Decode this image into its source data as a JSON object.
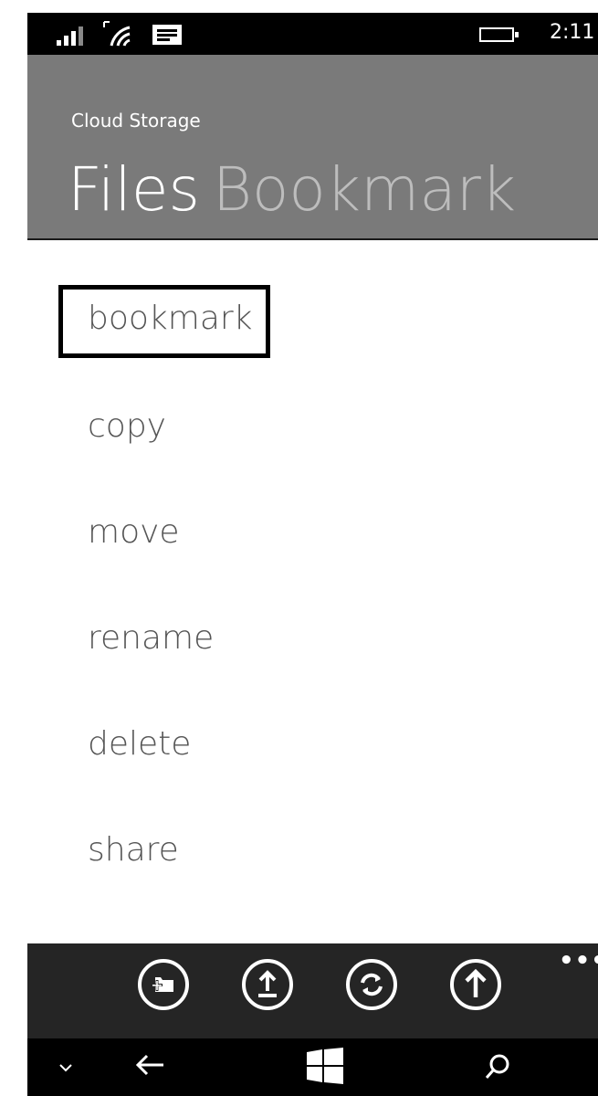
{
  "status_bar": {
    "time": "2:11",
    "icons": [
      "signal-icon",
      "wifi-icon",
      "message-icon",
      "battery-icon"
    ]
  },
  "header": {
    "app_title": "Cloud Storage",
    "pivots": [
      "Files",
      "Bookmark"
    ],
    "active_pivot": "Files"
  },
  "menu": {
    "items": [
      "bookmark",
      "copy",
      "move",
      "rename",
      "delete",
      "share"
    ],
    "focused": "bookmark"
  },
  "app_bar": {
    "buttons": [
      "new-folder-icon",
      "upload-icon",
      "sync-icon",
      "up-arrow-icon"
    ],
    "more": "•••"
  },
  "nav_bar": {
    "buttons": [
      "chevron-down-icon",
      "back-icon",
      "windows-icon",
      "search-icon"
    ]
  },
  "colors": {
    "header_bg": "#7a7a7a",
    "app_bar_bg": "#252525",
    "menu_text": "#555555",
    "focus_border": "#000000"
  }
}
